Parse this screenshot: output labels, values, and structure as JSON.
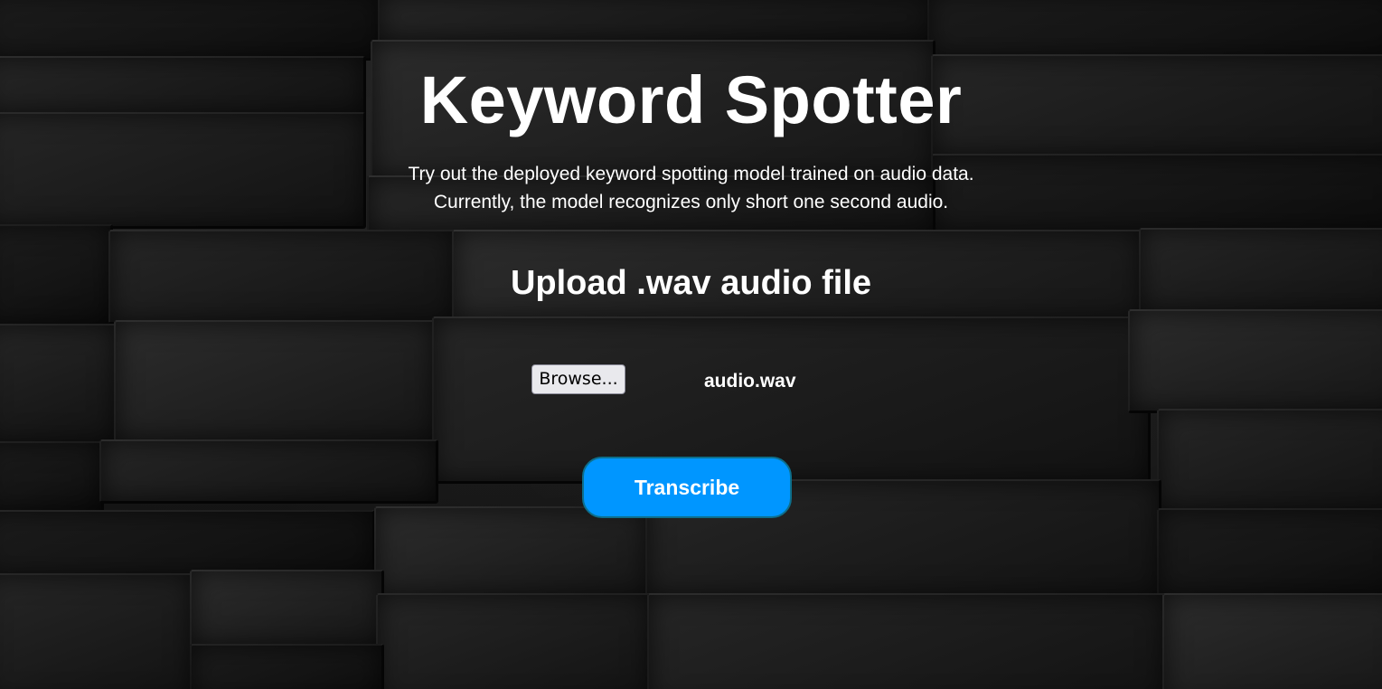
{
  "page": {
    "title": "Keyword Spotter",
    "description_lines": [
      "Try out the deployed keyword spotting model trained on audio data.",
      "Currently, the model recognizes only short one second audio."
    ]
  },
  "upload": {
    "heading": "Upload .wav audio file",
    "browse_label": "Browse...",
    "file_name": "audio.wav"
  },
  "actions": {
    "transcribe_label": "Transcribe",
    "transcribe_color": "#0096ff"
  },
  "theme": {
    "background": "dark-stone-wall"
  }
}
